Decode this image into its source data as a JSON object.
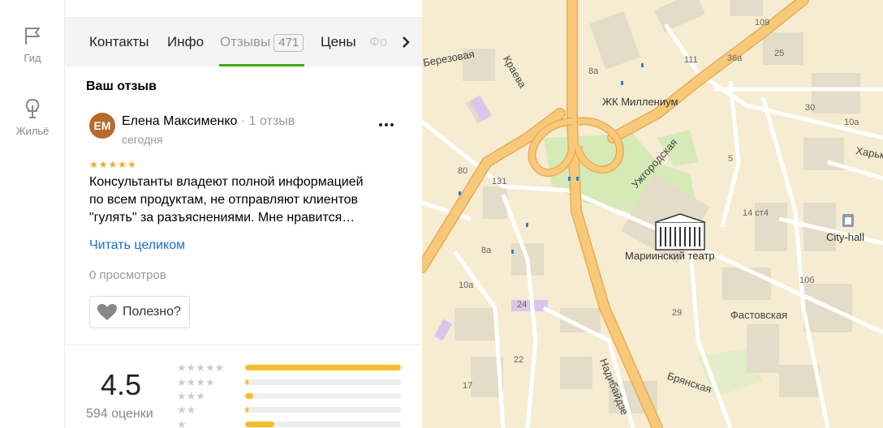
{
  "rail": {
    "items": [
      {
        "label": "Гид",
        "icon": "flag-icon"
      },
      {
        "label": "Жильё",
        "icon": "tree-house-icon"
      }
    ]
  },
  "tabs": {
    "items": [
      {
        "label": "Контакты"
      },
      {
        "label": "Инфо"
      },
      {
        "label": "Отзывы",
        "count": "471",
        "active": true
      },
      {
        "label": "Цены"
      },
      {
        "label": "Фо"
      }
    ]
  },
  "review": {
    "section_title": "Ваш отзыв",
    "avatar_initials": "ЕМ",
    "author": "Елена Максименко",
    "author_meta": "· 1 отзыв",
    "date": "сегодня",
    "stars": "★★★★★",
    "rating_value": 5,
    "text_lines": [
      "Консультанты владеют полной информацией",
      "по всем продуктам, не отправляют клиентов",
      "\"гулять\" за разъяснениями. Мне нравится…"
    ],
    "read_more": "Читать целиком",
    "views": "0 просмотров",
    "helpful_label": "Полезно?"
  },
  "summary": {
    "rating": "4.5",
    "count": "594 оценки",
    "distribution": [
      {
        "stars": "★★★★★",
        "fraction": 1.0
      },
      {
        "stars": "★★★★",
        "fraction": 0.02
      },
      {
        "stars": "★★★",
        "fraction": 0.05
      },
      {
        "stars": "★★",
        "fraction": 0.02
      },
      {
        "stars": "★",
        "fraction": 0.19
      }
    ]
  },
  "map": {
    "labels": {
      "zhk": "ЖК Миллениум",
      "theatre": "Мариинский театр",
      "city_hall": "City-hall",
      "uzhgorodskaya": "Ужгородская",
      "fastovskaya": "Фастовская",
      "nadibaidze": "Надибайдзе",
      "bryanskaya": "Брянская",
      "kraeva": "Краева",
      "berezovaya": "Березовая",
      "kharkovskaya": "Харьк",
      "n109": "109",
      "n111": "111",
      "n36a": "36а",
      "n25": "25",
      "n30": "30",
      "n10a_r": "10а",
      "n5": "5",
      "n14st4": "14 ст4",
      "n10b": "10б",
      "n29": "29",
      "n8a_t": "8а",
      "n80": "80",
      "n131": "131",
      "n8a_m": "8а",
      "n10a_l": "10а",
      "n24": "24",
      "n22": "22",
      "n17": "17"
    },
    "colors": {
      "base": "#f5ecd2",
      "road_major": "#f9c97a",
      "road_major_edge": "#e8ad55",
      "road_minor": "#ffffff",
      "green": "#d6eab7",
      "building": "#e2dcc8"
    }
  }
}
